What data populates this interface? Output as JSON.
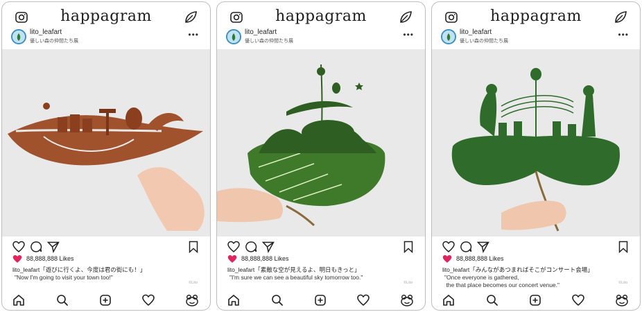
{
  "app": {
    "logo_text": "happagram"
  },
  "posts": [
    {
      "username": "lito_leafart",
      "subtitle": "優しい森の仲間たち展",
      "likes": "88,888,888 Likes",
      "caption_user": "lito_leafart",
      "caption_jp": "「遊びに行くよ、今度は君の街にも！」",
      "caption_en": "\"Now I'm going to visit your town too!\"",
      "credit": "©Lito",
      "leaf_color": "#a0522d"
    },
    {
      "username": "lito_leafart",
      "subtitle": "優しい森の仲間たち展",
      "likes": "88,888,888 Likes",
      "caption_user": "lito_leafart",
      "caption_jp": "「素敵な空が見えるよ、明日もきっと」",
      "caption_en": "\"I'm sure we can see a beautiful sky tomorrow too.\"",
      "credit": "©Lito",
      "leaf_color": "#3f7a2a"
    },
    {
      "username": "lito_leafart",
      "subtitle": "優しい森の仲間たち展",
      "likes": "88,888,888 Likes",
      "caption_user": "lito_leafart",
      "caption_jp": "「みんながあつまればそこがコンサート会場」",
      "caption_en": "\"Once everyone is gathered,\n the that place becomes our concert venue.\"",
      "credit": "©Lito",
      "leaf_color": "#2f6b2a"
    }
  ],
  "icons": {
    "top": [
      "camera-icon",
      "leaf-icon"
    ],
    "header": [
      "more-options-icon"
    ],
    "actions": [
      "heart-outline-icon",
      "comment-icon",
      "share-icon",
      "bookmark-icon"
    ],
    "likes": "heart-filled-icon",
    "bottom_nav": [
      "home-icon",
      "search-icon",
      "add-post-icon",
      "activity-heart-icon",
      "profile-frog-icon"
    ]
  },
  "colors": {
    "like_heart": "#e0245e",
    "avatar_ring": "#3b8fc6",
    "background_photo": "#e9e9e9"
  }
}
